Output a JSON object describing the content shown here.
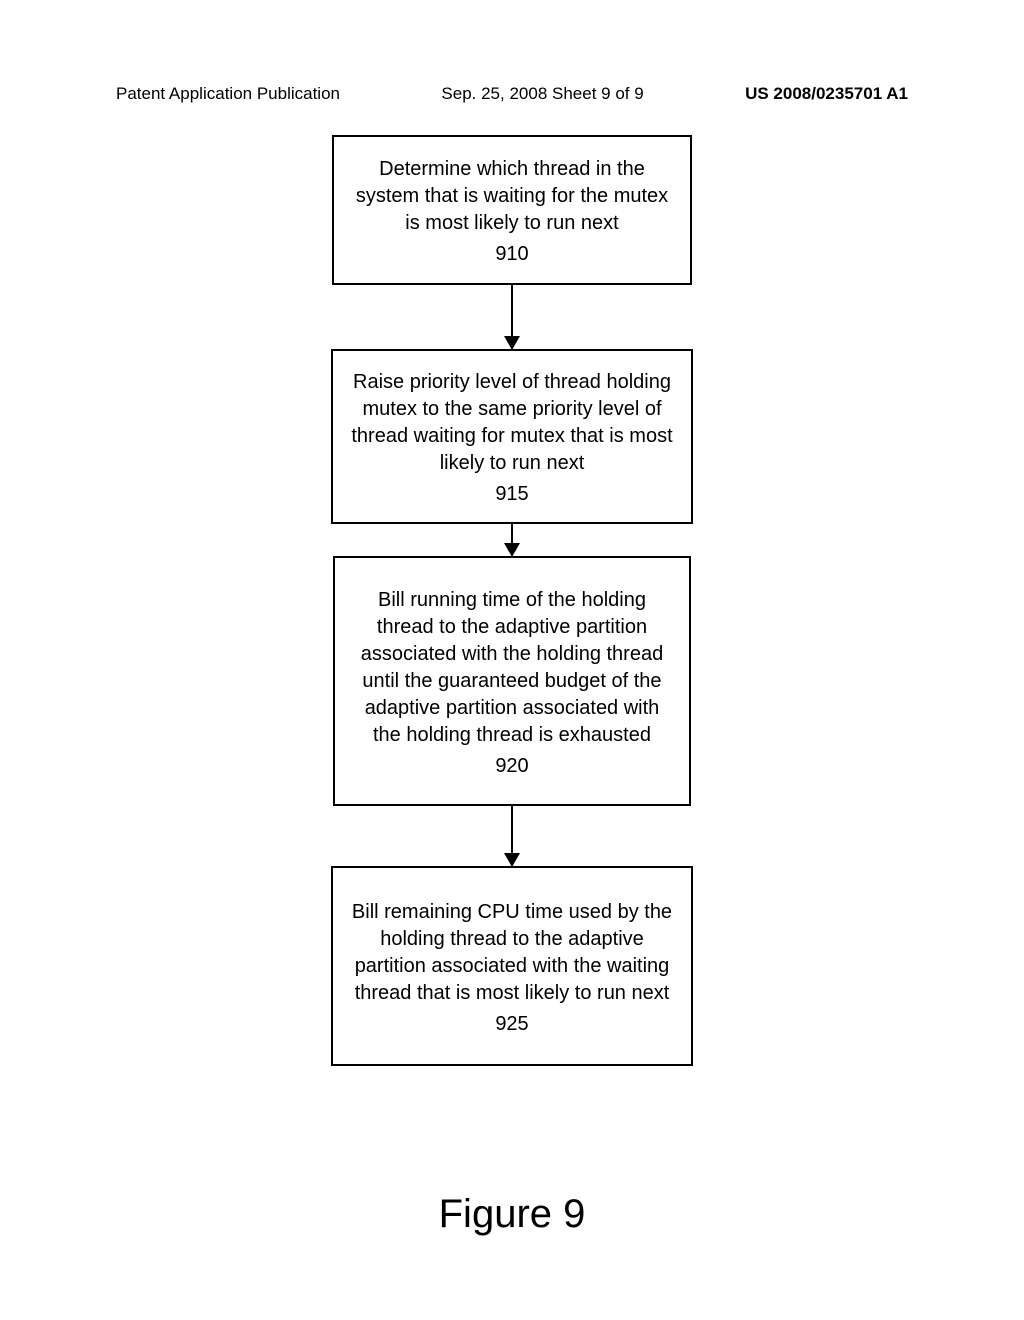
{
  "header": {
    "left": "Patent Application Publication",
    "center": "Sep. 25, 2008  Sheet 9 of 9",
    "right": "US 2008/0235701 A1"
  },
  "flow": {
    "box1": {
      "text": "Determine which thread in the system that is waiting for the mutex is most likely to run next",
      "ref": "910"
    },
    "box2": {
      "text": "Raise priority level of thread holding mutex to the same priority level of thread waiting for mutex that is most likely to run next",
      "ref": "915"
    },
    "box3": {
      "text": "Bill running time of the holding thread to the adaptive partition associated with the holding thread until the guaranteed budget of the adaptive partition associated with the holding thread is exhausted",
      "ref": "920"
    },
    "box4": {
      "text": "Bill remaining CPU time used by the holding thread to the adaptive partition associated with the waiting thread that is most likely to run next",
      "ref": "925"
    }
  },
  "figure_caption": "Figure 9"
}
